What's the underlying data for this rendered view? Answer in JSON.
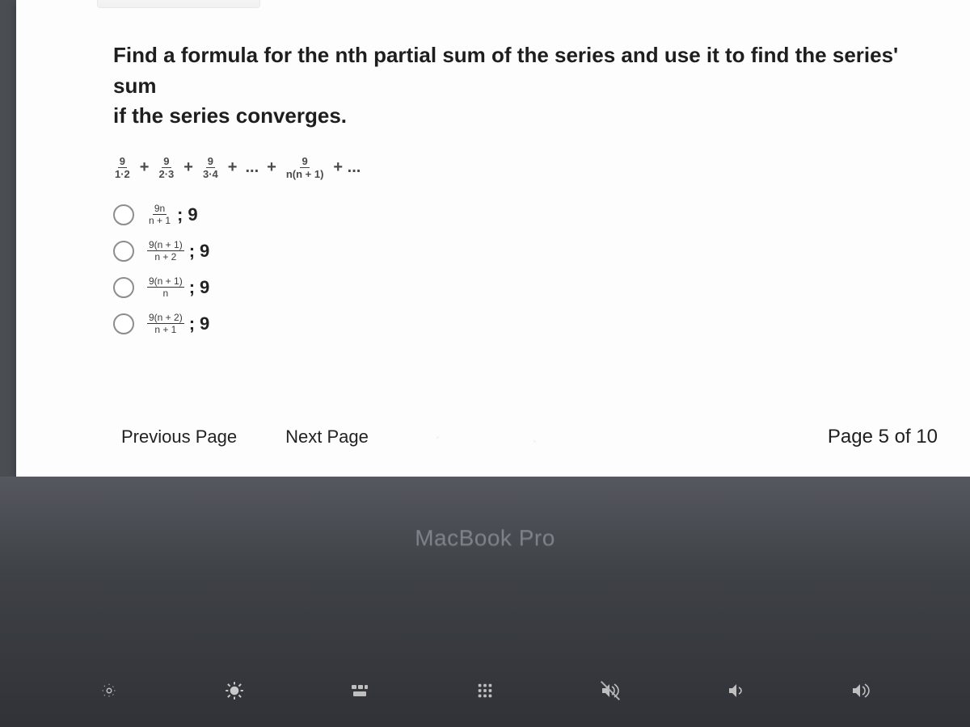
{
  "question": {
    "line1": "Find a formula for the nth partial sum of the series and use it to find the series' sum",
    "line2": "if the series converges."
  },
  "series": {
    "terms": [
      {
        "num": "9",
        "den": "1·2"
      },
      {
        "num": "9",
        "den": "2·3"
      },
      {
        "num": "9",
        "den": "3·4"
      }
    ],
    "mid_ellipsis": "...",
    "general_term": {
      "num": "9",
      "den": "n(n + 1)"
    },
    "trailing": "+ ...",
    "plus": "+"
  },
  "options": [
    {
      "frac_num": "9n",
      "frac_den": "n + 1",
      "sep": ";",
      "sum": "9"
    },
    {
      "frac_num": "9(n + 1)",
      "frac_den": "n + 2",
      "sep": ";",
      "sum": "9"
    },
    {
      "frac_num": "9(n + 1)",
      "frac_den": "n",
      "sep": ";",
      "sum": "9"
    },
    {
      "frac_num": "9(n + 2)",
      "frac_den": "n + 1",
      "sep": ";",
      "sum": "9"
    }
  ],
  "nav": {
    "prev": "Previous Page",
    "next": "Next Page",
    "page_label": "Page 5 of 10"
  },
  "device_label": "MacBook Pro",
  "fn_keys": [
    "brightness-low-icon",
    "brightness-high-icon",
    "mission-control-icon",
    "launchpad-icon",
    "mute-icon",
    "volume-low-icon",
    "volume-high-icon"
  ]
}
